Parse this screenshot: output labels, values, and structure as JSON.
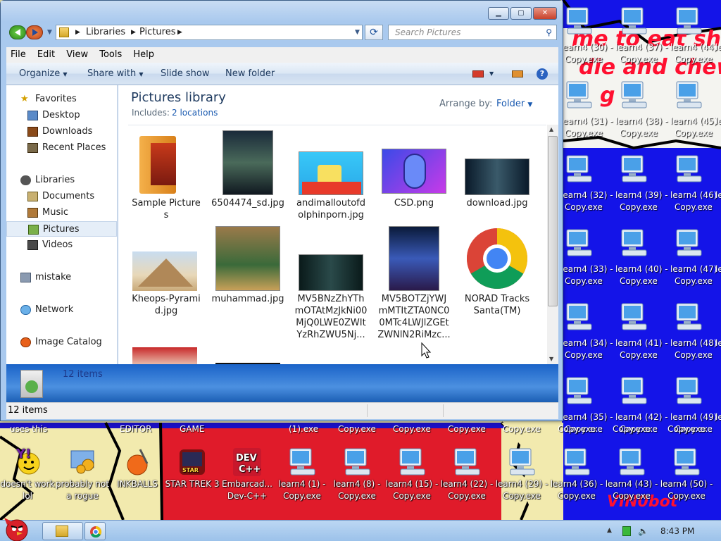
{
  "window": {
    "breadcrumb": [
      "Libraries",
      "Pictures"
    ],
    "search_placeholder": "Search Pictures",
    "menu": [
      "File",
      "Edit",
      "View",
      "Tools",
      "Help"
    ],
    "commands": [
      "Organize",
      "Share with",
      "Slide show",
      "New folder"
    ],
    "nav": {
      "favorites": "Favorites",
      "desktop": "Desktop",
      "downloads": "Downloads",
      "recent": "Recent Places",
      "libraries": "Libraries",
      "documents": "Documents",
      "music": "Music",
      "pictures": "Pictures",
      "videos": "Videos",
      "mistake": "mistake",
      "network": "Network",
      "image_catalog": "Image Catalog"
    },
    "library_title": "Pictures library",
    "includes_label": "Includes:",
    "includes_link": "2 locations",
    "arrange_label": "Arrange by:",
    "arrange_value": "Folder",
    "files": [
      "Sample Pictures",
      "6504474_sd.jpg",
      "andimalloutofdolphinporn.jpg",
      "CSD.png",
      "download.jpg",
      "Kheops-Pyramid.jpg",
      "muhammad.jpg",
      "MV5BNzZhYThmOTAtMzJkNi00MjQ0LWE0ZWItYzRhZWU5Nj...",
      "MV5BOTZjYWJmMTItZTA0NC00MTc4LWJlZGEtZWNlN2RiMzc...",
      "NORAD Tracks Santa(TM)"
    ],
    "detail_count": "12 items",
    "status": "12 items"
  },
  "desktop": {
    "graffiti": [
      "me to eat shi",
      "die and chew",
      "g"
    ],
    "bottom_icons": [
      {
        "label": "doesn't work lol"
      },
      {
        "label": "probably not a rogue"
      },
      {
        "label": "INKBALLS"
      },
      {
        "label": "STAR TREK 3"
      },
      {
        "label": "Embarcad... Dev-C++"
      },
      {
        "label": "learn4 (1) - Copy.exe"
      },
      {
        "label": "learn4 (8) - Copy.exe"
      },
      {
        "label": "learn4 (15) - Copy.exe"
      },
      {
        "label": "learn4 (22) - Copy.exe"
      },
      {
        "label": "learn4 (29) - Copy.exe"
      },
      {
        "label": "learn4 (36) - Copy.exe"
      },
      {
        "label": "learn4 (43) - Copy.exe"
      },
      {
        "label": "learn4 (50) - Copy.exe"
      }
    ],
    "top_row_labels": [
      "uses this",
      "EDITOR",
      "GAME",
      "(1).exe",
      "Copy.exe",
      "Copy.exe",
      "Copy.exe",
      "Copy.exe",
      "Copy.exe",
      "Copy.exe",
      "Copy.exe"
    ],
    "right_grid": [
      [
        "learn4 (30) -",
        "Copy.exe",
        "learn4 (37) -",
        "Copy.exe",
        "learn4 (44) -",
        "Copy.exe"
      ],
      [
        "learn4 (31) -",
        "Copy.exe",
        "learn4 (38) -",
        "Copy.exe",
        "learn4 (45) -",
        "Copy.exe"
      ],
      [
        "learn4 (32) -",
        "Copy.exe",
        "learn4 (39) -",
        "Copy.exe",
        "learn4 (46) -",
        "Copy.exe"
      ],
      [
        "learn4 (33) -",
        "Copy.exe",
        "learn4 (40) -",
        "Copy.exe",
        "learn4 (47) -",
        "Copy.exe"
      ],
      [
        "learn4 (34) -",
        "Copy.exe",
        "learn4 (41) -",
        "Copy.exe",
        "learn4 (48) -",
        "Copy.exe"
      ],
      [
        "learn4 (35) -",
        "Copy.exe",
        "learn4 (42) -",
        "Copy.exe",
        "learn4 (49) -",
        "Copy.exe"
      ]
    ],
    "edge_label": "le",
    "signature": "VIN0bot"
  },
  "taskbar": {
    "clock": "8:43 PM"
  }
}
